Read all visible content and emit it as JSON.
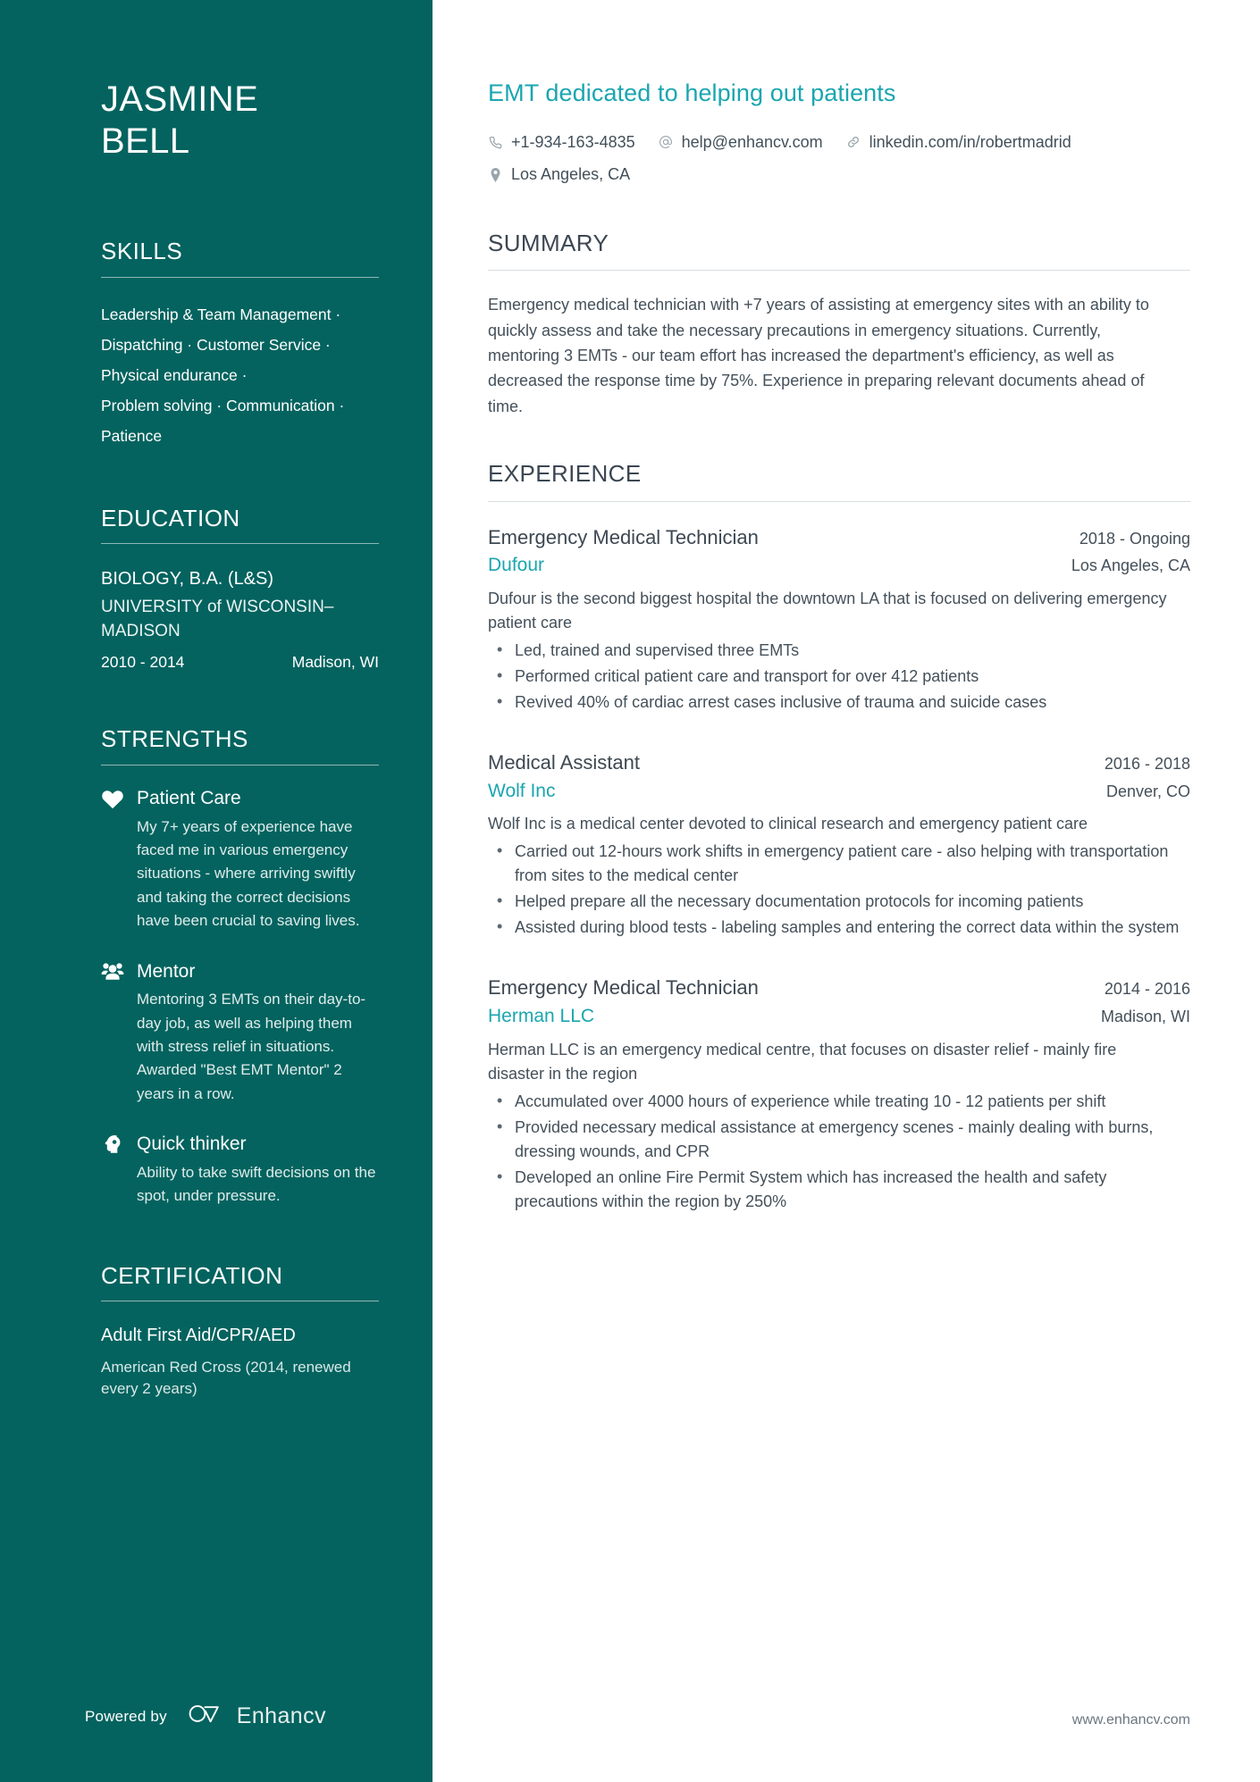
{
  "sidebar": {
    "name_first": "JASMINE",
    "name_last": "BELL",
    "skills": {
      "heading": "SKILLS",
      "lines": [
        "Leadership & Team Management ·",
        "Dispatching · Customer Service ·",
        "Physical endurance ·",
        "Problem solving · Communication ·",
        "Patience"
      ]
    },
    "education": {
      "heading": "EDUCATION",
      "degree": "BIOLOGY, B.A. (L&S)",
      "school": "UNIVERSITY of WISCONSIN–MADISON",
      "years": "2010 - 2014",
      "location": "Madison, WI"
    },
    "strengths": {
      "heading": "STRENGTHS",
      "items": [
        {
          "icon": "heart-icon",
          "title": "Patient Care",
          "body": "My 7+ years of experience have faced me in various emergency situations - where arriving swiftly and taking the correct decisions have been crucial to saving lives."
        },
        {
          "icon": "users-group-icon",
          "title": "Mentor",
          "body": "Mentoring 3 EMTs on their day-to-day job, as well as helping them with stress relief in situations. Awarded \"Best EMT Mentor\" 2 years in a row."
        },
        {
          "icon": "brain-head-icon",
          "title": "Quick thinker",
          "body": "Ability to take swift decisions on the spot, under pressure."
        }
      ]
    },
    "certification": {
      "heading": "CERTIFICATION",
      "title": "Adult First Aid/CPR/AED",
      "subtitle": "American Red Cross (2014, renewed every 2 years)"
    },
    "footer": {
      "powered_by": "Powered by",
      "brand": "Enhancv"
    }
  },
  "main": {
    "headline": "EMT dedicated to helping out patients",
    "contacts": [
      {
        "icon": "phone-icon",
        "text": "+1-934-163-4835"
      },
      {
        "icon": "at-email-icon",
        "text": "help@enhancv.com"
      },
      {
        "icon": "link-icon",
        "text": "linkedin.com/in/robertmadrid"
      },
      {
        "icon": "location-pin-icon",
        "text": "Los Angeles, CA"
      }
    ],
    "summary": {
      "heading": "SUMMARY",
      "text": "Emergency medical technician with +7 years of assisting at emergency sites with an ability to quickly assess and take the necessary precautions in emergency situations. Currently, mentoring 3 EMTs - our team effort has increased the department's efficiency, as well as decreased the response time by 75%. Experience in preparing relevant documents ahead of time."
    },
    "experience": {
      "heading": "EXPERIENCE",
      "jobs": [
        {
          "title": "Emergency Medical Technician",
          "dates": "2018 - Ongoing",
          "company": "Dufour",
          "location": "Los Angeles, CA",
          "description": "Dufour is the second biggest hospital the downtown LA that is focused on delivering emergency patient care",
          "bullets": [
            "Led, trained and supervised three EMTs",
            "Performed critical patient care and transport for over 412 patients",
            "Revived 40% of cardiac arrest cases inclusive of trauma and suicide cases"
          ]
        },
        {
          "title": "Medical Assistant",
          "dates": "2016 - 2018",
          "company": "Wolf Inc",
          "location": "Denver, CO",
          "description": "Wolf Inc is a medical center devoted to clinical research and emergency patient care",
          "bullets": [
            "Carried out 12-hours work shifts in emergency patient care - also helping with transportation from sites to the medical center",
            "Helped prepare all the necessary documentation protocols for incoming patients",
            "Assisted during blood tests - labeling samples and entering the correct data within the system"
          ]
        },
        {
          "title": "Emergency Medical Technician",
          "dates": "2014 - 2016",
          "company": "Herman LLC",
          "location": "Madison, WI",
          "description": "Herman LLC is an emergency medical centre, that focuses on disaster relief - mainly fire disaster in the region",
          "bullets": [
            "Accumulated over 4000 hours of experience while treating 10 - 12 patients per shift",
            "Provided necessary medical assistance at emergency scenes - mainly dealing with burns, dressing wounds, and CPR",
            "Developed an online Fire Permit System which has increased the health and safety precautions within the region by 250%"
          ]
        }
      ]
    },
    "footer_url": "www.enhancv.com"
  },
  "colors": {
    "sidebar_bg": "#04635f",
    "accent_teal": "#1aa6b0",
    "body_text": "#44505a"
  }
}
